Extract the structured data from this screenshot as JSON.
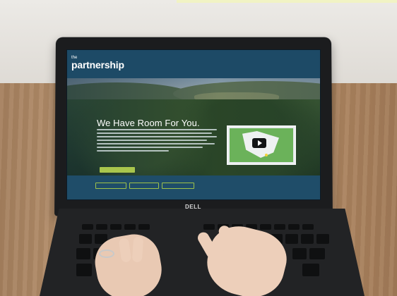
{
  "photo": {
    "subject": "laptop-on-table"
  },
  "laptop": {
    "brand_label": "DELL"
  },
  "website": {
    "logo": {
      "small": "the",
      "big": "partnership",
      "tagline": ""
    },
    "nav_items": [
      "",
      "",
      "",
      "",
      "",
      ""
    ],
    "hero": {
      "headline": "We Have Room For You.",
      "cta_label": ""
    },
    "video": {
      "icon": "play-icon"
    },
    "subnav": [
      "",
      "",
      ""
    ],
    "colors": {
      "header": "#1d4a66",
      "accent": "#a9c64d"
    }
  }
}
